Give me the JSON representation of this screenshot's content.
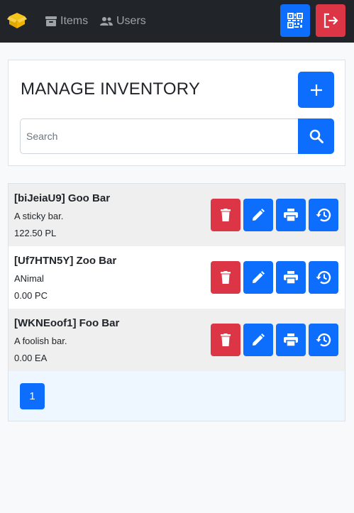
{
  "navbar": {
    "brand_icon": "box-open-icon",
    "links": [
      {
        "label": "Items",
        "icon": "archive-icon"
      },
      {
        "label": "Users",
        "icon": "users-icon"
      }
    ],
    "buttons": [
      {
        "icon": "qr-code-icon",
        "color": "#0d6efd"
      },
      {
        "icon": "logout-icon",
        "color": "#dc3545"
      }
    ]
  },
  "header": {
    "title": "MANAGE INVENTORY",
    "add_icon": "plus-icon",
    "search": {
      "placeholder": "Search",
      "value": ""
    },
    "search_icon": "search-icon"
  },
  "items": [
    {
      "title": "[biJeiaU9] Goo Bar",
      "description": "A sticky bar.",
      "quantity": "122.50 PL"
    },
    {
      "title": "[Uf7HTN5Y] Zoo Bar",
      "description": "ANimal",
      "quantity": "0.00 PC"
    },
    {
      "title": "[WKNEoof1] Foo Bar",
      "description": "A foolish bar.",
      "quantity": "0.00 EA"
    }
  ],
  "item_actions": [
    {
      "icon": "trash-icon",
      "color": "#dc3545"
    },
    {
      "icon": "pencil-icon",
      "color": "#0d6efd"
    },
    {
      "icon": "printer-icon",
      "color": "#0d6efd"
    },
    {
      "icon": "history-icon",
      "color": "#0d6efd"
    }
  ],
  "pagination": {
    "current": "1"
  },
  "colors": {
    "primary": "#0d6efd",
    "danger": "#dc3545",
    "navbar": "#212529",
    "brand": "#f0b400"
  }
}
